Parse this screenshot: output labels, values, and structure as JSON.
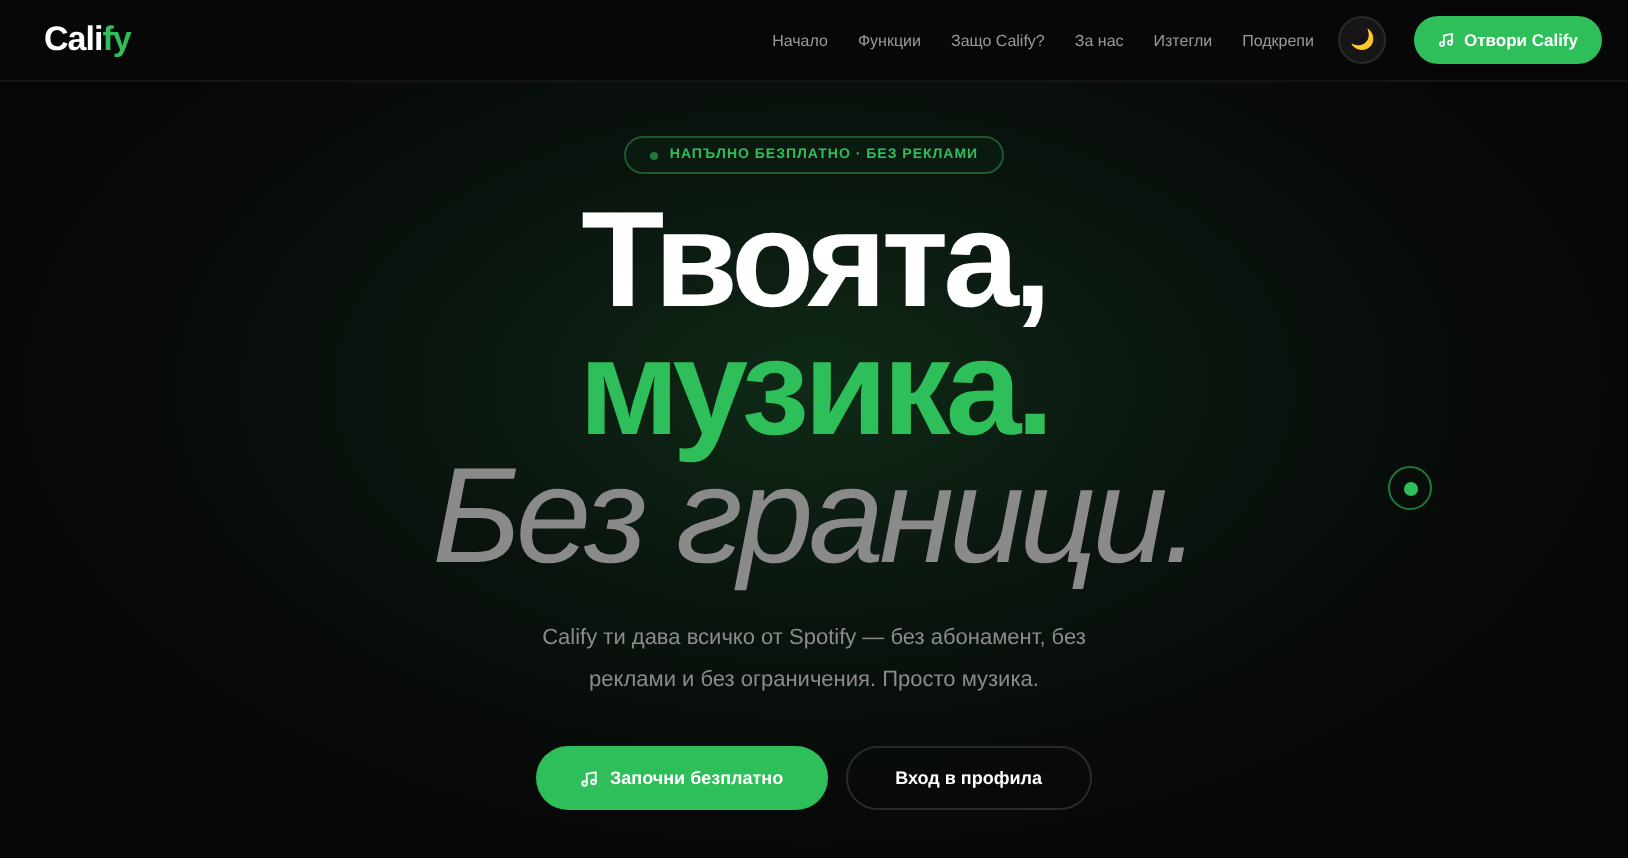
{
  "logo": {
    "main": "Cali",
    "accent": "fy"
  },
  "nav": [
    "Начало",
    "Функции",
    "Защо Califу?",
    "За нас",
    "Изтегли",
    "Подкрепи"
  ],
  "theme_toggle": {
    "symbol": "🌙"
  },
  "cta": "Отвори Califу",
  "badge": "НАПЪЛНО БЕЗПЛАТНО · БЕЗ РЕКЛАМИ",
  "headline": [
    {
      "text": "Твоята,",
      "kind": "plain"
    },
    {
      "text": "музика.",
      "kind": "accent"
    },
    {
      "text": "Без граници.",
      "kind": "muted"
    }
  ],
  "description": "Califу ти дава всичко от Spotify — без абонамент, без реклами и без ограничения. Просто музика.",
  "buttons": [
    {
      "label": "Започни безплатно",
      "kind": "primary"
    },
    {
      "label": "Вход в профила",
      "kind": "secondary"
    }
  ]
}
